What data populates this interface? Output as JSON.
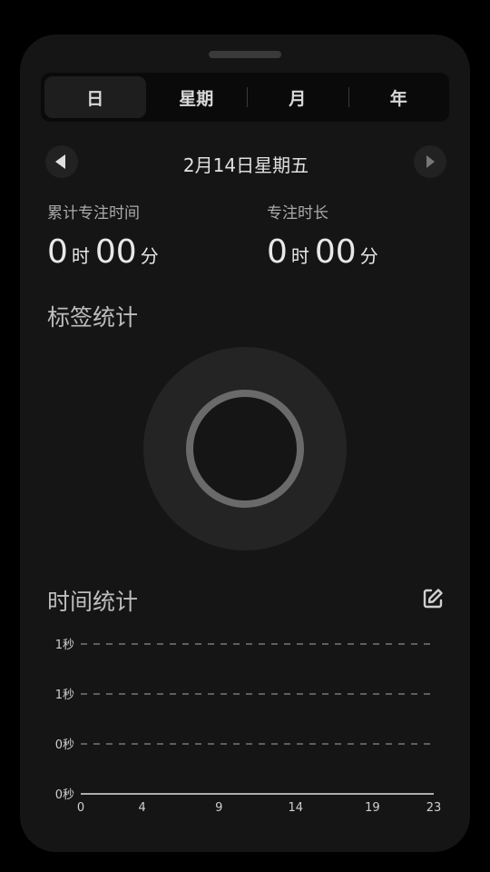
{
  "tabs": [
    {
      "label": "日",
      "active": true
    },
    {
      "label": "星期",
      "active": false
    },
    {
      "label": "月",
      "active": false
    },
    {
      "label": "年",
      "active": false
    }
  ],
  "date": {
    "label": "2月14日星期五",
    "prev_icon": "triangle-left-icon",
    "next_icon": "triangle-right-icon"
  },
  "stats": {
    "total": {
      "label": "累计专注时间",
      "hours": "0",
      "hour_unit": "时",
      "minutes": "00",
      "minute_unit": "分"
    },
    "duration": {
      "label": "专注时长",
      "hours": "0",
      "hour_unit": "时",
      "minutes": "00",
      "minute_unit": "分"
    }
  },
  "tag_stats": {
    "title": "标签统计"
  },
  "time_stats": {
    "title": "时间统计",
    "edit_icon": "edit-icon"
  },
  "colors": {
    "background": "#151515",
    "accent": "#e0e0e0",
    "ring": "#6a6a6a"
  },
  "chart_data": {
    "type": "line",
    "y_tick_labels": [
      "1秒",
      "1秒",
      "0秒",
      "0秒"
    ],
    "x_tick_labels": [
      "0",
      "4",
      "9",
      "14",
      "19",
      "23"
    ],
    "x": [
      0,
      23
    ],
    "series": [
      {
        "values": [
          0,
          0
        ]
      }
    ],
    "xlim": [
      0,
      23
    ],
    "ylim": [
      0,
      1
    ],
    "grid": true
  }
}
